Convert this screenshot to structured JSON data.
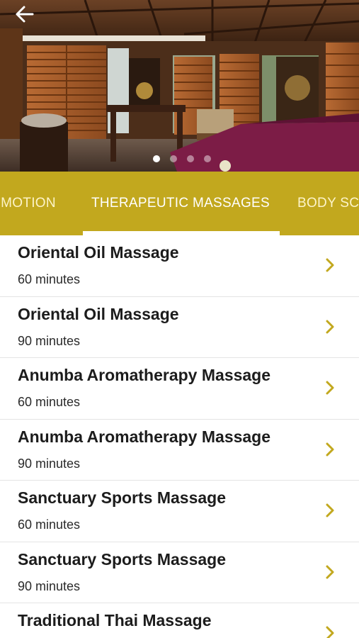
{
  "header": {
    "back_icon": "arrow-left-icon",
    "carousel_pages": 4,
    "carousel_active_index": 0
  },
  "tabs": {
    "items": [
      {
        "label": "OMOTION"
      },
      {
        "label": "THERAPEUTIC MASSAGES"
      },
      {
        "label": "BODY SC"
      }
    ],
    "active_index": 1,
    "colors": {
      "bar": "#c2a81e",
      "indicator": "#ffffff"
    }
  },
  "treatments": [
    {
      "name": "Oriental Oil Massage",
      "duration": "60 minutes"
    },
    {
      "name": "Oriental Oil Massage",
      "duration": "90 minutes"
    },
    {
      "name": "Anumba Aromatherapy Massage",
      "duration": "60 minutes"
    },
    {
      "name": "Anumba Aromatherapy Massage",
      "duration": "90 minutes"
    },
    {
      "name": "Sanctuary Sports Massage",
      "duration": "60 minutes"
    },
    {
      "name": "Sanctuary Sports Massage",
      "duration": "90 minutes"
    },
    {
      "name": "Traditional Thai Massage",
      "duration": ""
    }
  ],
  "colors": {
    "accent": "#c2a81e",
    "chevron": "#c2a81e",
    "title_text": "#1c1c1c"
  }
}
